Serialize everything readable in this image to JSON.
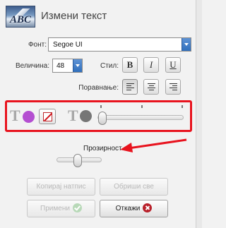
{
  "header": {
    "logo_text": "ABC",
    "title": "Измени текст"
  },
  "font": {
    "label": "Фонт:",
    "value": "Segoe UI"
  },
  "size": {
    "label": "Величина:",
    "value": "48"
  },
  "style": {
    "label": "Стил:",
    "bold": "B",
    "italic": "I",
    "underline": "U"
  },
  "alignment": {
    "label": "Поравнање:",
    "selected": "left"
  },
  "colors": {
    "text_glyph": "T",
    "text_color": "#b44fd1",
    "outline_color": "#767676",
    "accent_box": "#e8131e",
    "slider_level": 0.05
  },
  "opacity": {
    "label": "Прозирност",
    "level": 0.35
  },
  "buttons": {
    "copy_caption": "Копирај натпис",
    "delete_all": "Обриши све",
    "apply": "Примени",
    "cancel": "Откажи"
  }
}
